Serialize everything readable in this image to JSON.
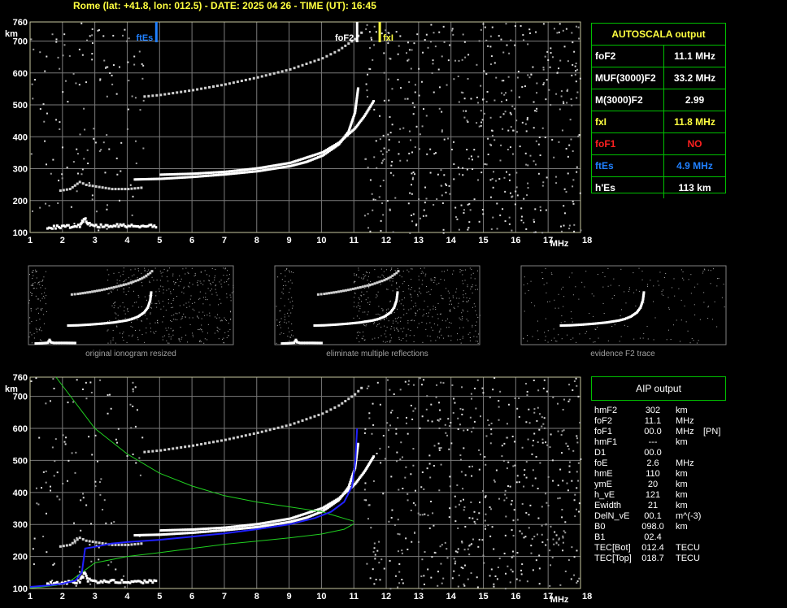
{
  "header": {
    "title": "Rome (lat: +41.8, lon: 012.5) - DATE: 2025 04 26 - TIME (UT): 16:45"
  },
  "colors": {
    "grid": "#7a7a7a",
    "frame": "#c8c8a0",
    "text": "#ffffff",
    "yellow": "#ffff40",
    "blue": "#2080ff",
    "red": "#ff2020",
    "green": "#00c000",
    "model": "#20d020",
    "profile": "#2020ff"
  },
  "chart_data": [
    {
      "type": "scatter",
      "name": "main-ionogram",
      "xlabel": "MHz",
      "ylabel": "km",
      "xlim": [
        1,
        18
      ],
      "ylim": [
        100,
        760
      ],
      "xticks": [
        1,
        2,
        3,
        4,
        5,
        6,
        7,
        8,
        9,
        10,
        11,
        12,
        13,
        14,
        15,
        16,
        17,
        18
      ],
      "yticks": [
        100,
        200,
        300,
        400,
        500,
        600,
        700,
        760
      ],
      "markers": [
        {
          "label": "ftEs",
          "x": 4.9,
          "color": "#2080ff"
        },
        {
          "label": "foF2",
          "x": 11.1,
          "color": "#ffffff"
        },
        {
          "label": "fxI",
          "x": 11.8,
          "color": "#ffff40"
        }
      ],
      "traces": {
        "E_es": [
          [
            1.5,
            120
          ],
          [
            2.0,
            122
          ],
          [
            2.5,
            126
          ],
          [
            2.65,
            150
          ],
          [
            2.75,
            130
          ],
          [
            3.0,
            125
          ],
          [
            4.0,
            125
          ],
          [
            4.9,
            124
          ]
        ],
        "Es_second": [
          [
            1.9,
            235
          ],
          [
            2.2,
            240
          ],
          [
            2.5,
            262
          ],
          [
            2.7,
            253
          ],
          [
            3.0,
            248
          ],
          [
            3.5,
            240
          ],
          [
            4.0,
            240
          ],
          [
            4.5,
            245
          ]
        ],
        "F2_o": [
          [
            4.2,
            270
          ],
          [
            5,
            272
          ],
          [
            6,
            278
          ],
          [
            7,
            286
          ],
          [
            8,
            296
          ],
          [
            9,
            312
          ],
          [
            9.5,
            325
          ],
          [
            10,
            345
          ],
          [
            10.5,
            380
          ],
          [
            10.8,
            420
          ],
          [
            11.0,
            480
          ],
          [
            11.1,
            560
          ]
        ],
        "F2_x": [
          [
            5,
            285
          ],
          [
            6,
            288
          ],
          [
            7,
            294
          ],
          [
            8,
            305
          ],
          [
            9,
            322
          ],
          [
            10,
            355
          ],
          [
            10.5,
            385
          ],
          [
            11,
            430
          ],
          [
            11.3,
            470
          ],
          [
            11.6,
            520
          ]
        ],
        "F2_second": [
          [
            4.5,
            530
          ],
          [
            5,
            535
          ],
          [
            6,
            550
          ],
          [
            7,
            568
          ],
          [
            8,
            590
          ],
          [
            9,
            615
          ],
          [
            10,
            650
          ],
          [
            10.5,
            675
          ],
          [
            11,
            710
          ],
          [
            11.3,
            740
          ]
        ]
      }
    },
    {
      "type": "scatter",
      "name": "aip-ionogram",
      "xlabel": "MHz",
      "ylabel": "km",
      "xlim": [
        1,
        18
      ],
      "ylim": [
        100,
        760
      ],
      "xticks": [
        1,
        2,
        3,
        4,
        5,
        6,
        7,
        8,
        9,
        10,
        11,
        12,
        13,
        14,
        15,
        16,
        17,
        18
      ],
      "yticks": [
        100,
        200,
        300,
        400,
        500,
        600,
        700,
        760
      ],
      "profile": [
        [
          1.0,
          105
        ],
        [
          1.6,
          110
        ],
        [
          2.0,
          115
        ],
        [
          2.4,
          125
        ],
        [
          2.6,
          150
        ],
        [
          2.7,
          225
        ],
        [
          3.0,
          230
        ],
        [
          3.5,
          240
        ],
        [
          4,
          245
        ],
        [
          5,
          252
        ],
        [
          6,
          262
        ],
        [
          7,
          272
        ],
        [
          8,
          285
        ],
        [
          9,
          300
        ],
        [
          9.8,
          320
        ],
        [
          10.3,
          340
        ],
        [
          10.7,
          370
        ],
        [
          10.95,
          420
        ],
        [
          11.05,
          500
        ],
        [
          11.1,
          600
        ]
      ],
      "model": [
        [
          11.0,
          302
        ],
        [
          10.7,
          285
        ],
        [
          10,
          270
        ],
        [
          9,
          258
        ],
        [
          8,
          248
        ],
        [
          7,
          238
        ],
        [
          6,
          225
        ],
        [
          5,
          212
        ],
        [
          4,
          200
        ],
        [
          3,
          180
        ],
        [
          2.6,
          150
        ],
        [
          2.2,
          120
        ],
        [
          1.8,
          110
        ],
        [
          1.3,
          104
        ],
        [
          1.0,
          102
        ]
      ],
      "model_top": [
        [
          11.0,
          310
        ],
        [
          10.5,
          325
        ],
        [
          10,
          340
        ],
        [
          9,
          355
        ],
        [
          8,
          370
        ],
        [
          7,
          390
        ],
        [
          6,
          420
        ],
        [
          5,
          460
        ],
        [
          4,
          520
        ],
        [
          3,
          600
        ],
        [
          2.4,
          680
        ],
        [
          1.8,
          760
        ]
      ]
    }
  ],
  "autoscala": {
    "title": "AUTOSCALA output",
    "rows": [
      {
        "key": "foF2",
        "value": "11.1 MHz",
        "color": "#ffffff"
      },
      {
        "key": "MUF(3000)F2",
        "value": "33.2 MHz",
        "color": "#ffffff"
      },
      {
        "key": "M(3000)F2",
        "value": "2.99",
        "color": "#ffffff"
      },
      {
        "key": "fxI",
        "value": "11.8 MHz",
        "color": "#ffff40"
      },
      {
        "key": "foF1",
        "value": "NO",
        "color": "#ff2020"
      },
      {
        "key": "ftEs",
        "value": "4.9 MHz",
        "color": "#2080ff"
      },
      {
        "key": "h'Es",
        "value": "113     km",
        "color": "#ffffff"
      }
    ]
  },
  "thumbnails": [
    {
      "caption": "original ionogram resized"
    },
    {
      "caption": "eliminate multiple reflections"
    },
    {
      "caption": "evidence F2 trace"
    }
  ],
  "aip": {
    "title": "AIP output",
    "rows": [
      {
        "key": "hmF2",
        "value": "302",
        "unit": "km",
        "note": ""
      },
      {
        "key": "foF2",
        "value": "11.1",
        "unit": "MHz",
        "note": ""
      },
      {
        "key": "foF1",
        "value": "00.0",
        "unit": "MHz",
        "note": "[PN]"
      },
      {
        "key": "hmF1",
        "value": "---",
        "unit": "km",
        "note": ""
      },
      {
        "key": "D1",
        "value": "00.0",
        "unit": "",
        "note": ""
      },
      {
        "key": "foE",
        "value": "2.6",
        "unit": "MHz",
        "note": ""
      },
      {
        "key": "hmE",
        "value": "110",
        "unit": "km",
        "note": ""
      },
      {
        "key": "ymE",
        "value": "20",
        "unit": "km",
        "note": ""
      },
      {
        "key": "h_vE",
        "value": "121",
        "unit": "km",
        "note": ""
      },
      {
        "key": "Ewidth",
        "value": "21",
        "unit": "km",
        "note": ""
      },
      {
        "key": "DelN_vE",
        "value": "00.1",
        "unit": "m^(-3)",
        "note": ""
      },
      {
        "key": "B0",
        "value": "098.0",
        "unit": "km",
        "note": ""
      },
      {
        "key": "B1",
        "value": "02.4",
        "unit": "",
        "note": ""
      },
      {
        "key": "TEC[Bot]",
        "value": "012.4",
        "unit": "TECU",
        "note": ""
      },
      {
        "key": "TEC[Top]",
        "value": "018.7",
        "unit": "TECU",
        "note": ""
      }
    ]
  }
}
